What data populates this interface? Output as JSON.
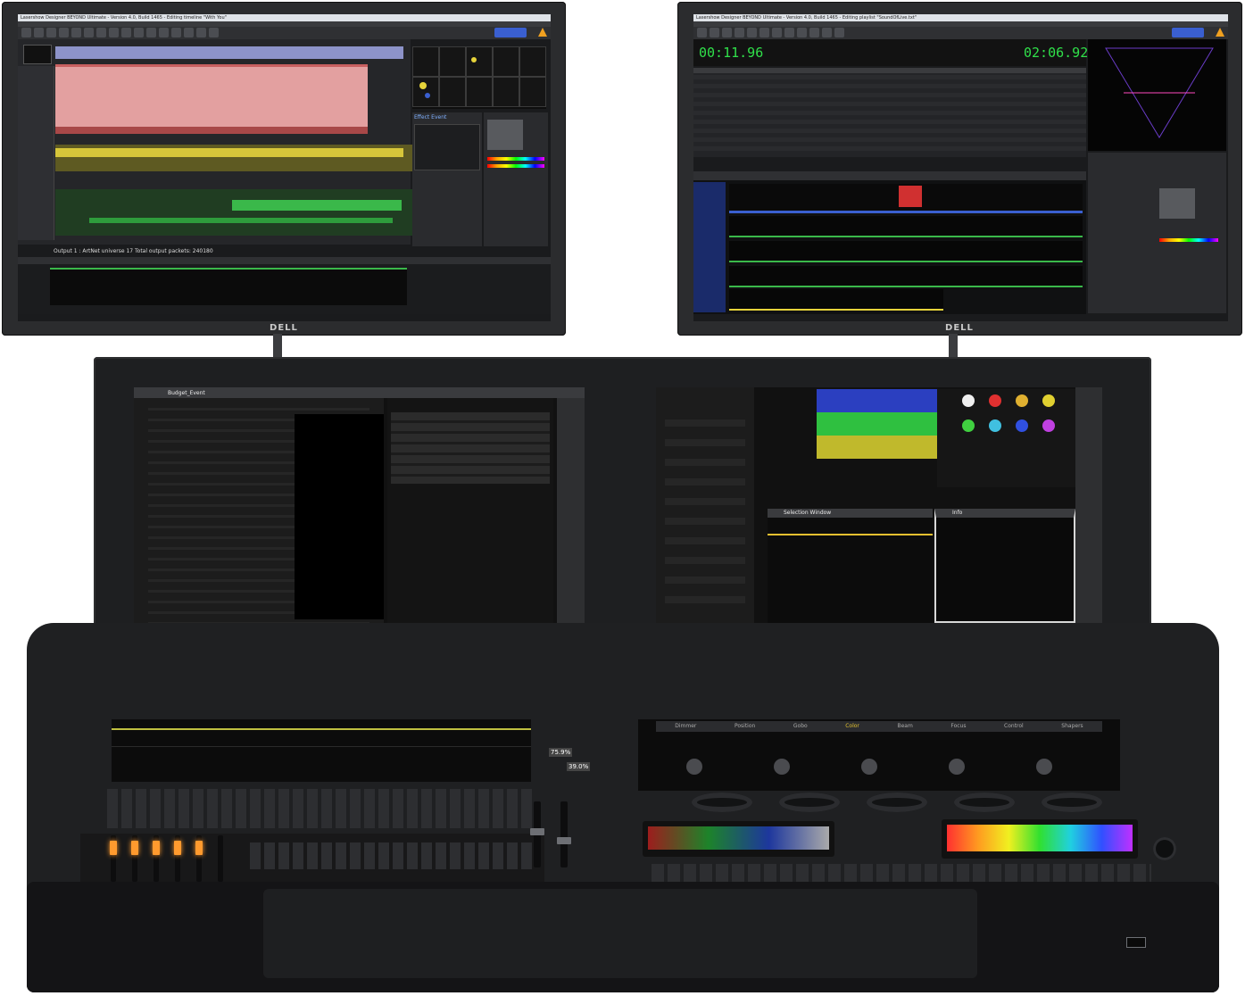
{
  "left_monitor": {
    "brand": "DELL",
    "title": "Lasershow Designer BEYOND Ultimate - Version 4.0, Build 1465 - Editing timeline \"With You\"",
    "status": "Output 1 : ArtNet universe 17  Total output packets: 240180",
    "effect_panel_title": "Effect Event"
  },
  "right_monitor": {
    "brand": "DELL",
    "title": "Lasershow Designer BEYOND Ultimate - Version 4.0, Build 1465 - Editing playlist \"SoundOfLive.txt\"",
    "time_elapsed": "00:11.96",
    "time_total": "02:06.92"
  },
  "console": {
    "left_screen": {
      "title": "Budget_Event"
    },
    "right_screen": {
      "window_title": "Selection Window",
      "info_title": "Info"
    },
    "encoder_tabs": [
      "Dimmer",
      "Position",
      "Gobo",
      "Color",
      "Beam",
      "Focus",
      "Control",
      "Shapers"
    ],
    "readouts": [
      "75.9%",
      "39.0%"
    ]
  },
  "colors": {
    "beyond_blue": "#3a5fd0",
    "track_red": "#e08a8a",
    "track_yellow": "#d7c63a",
    "track_green": "#3ab84a",
    "timer_green": "#30e04a",
    "fader_led": "#ff9a2e"
  }
}
